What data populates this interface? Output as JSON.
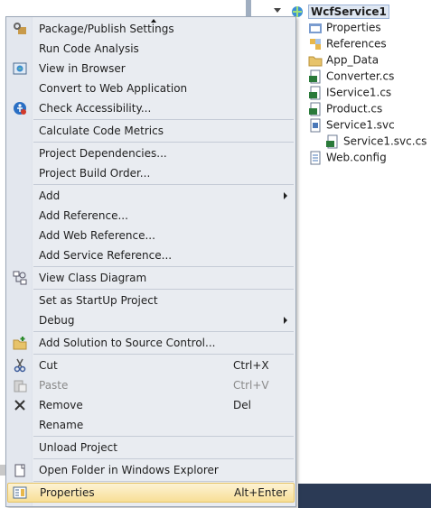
{
  "solution_explorer": {
    "root": "WcfService1",
    "items": [
      {
        "label": "Properties",
        "icon": "properties-folder-icon"
      },
      {
        "label": "References",
        "icon": "references-icon"
      },
      {
        "label": "App_Data",
        "icon": "folder-icon"
      },
      {
        "label": "Converter.cs",
        "icon": "csharp-file-icon"
      },
      {
        "label": "IService1.cs",
        "icon": "csharp-file-icon"
      },
      {
        "label": "Product.cs",
        "icon": "csharp-file-icon"
      },
      {
        "label": "Service1.svc",
        "icon": "svc-file-icon"
      },
      {
        "label": "Service1.svc.cs",
        "icon": "csharp-file-icon"
      },
      {
        "label": "Web.config",
        "icon": "config-file-icon"
      }
    ]
  },
  "context_menu": {
    "items": [
      {
        "label": "Package/Publish Settings",
        "icon": "package-settings-icon"
      },
      {
        "label": "Run Code Analysis"
      },
      {
        "label": "View in Browser",
        "icon": "view-in-browser-icon"
      },
      {
        "label": "Convert to Web Application"
      },
      {
        "label": "Check Accessibility...",
        "icon": "accessibility-icon"
      },
      {
        "label": "Calculate Code Metrics"
      },
      {
        "label": "Project Dependencies..."
      },
      {
        "label": "Project Build Order..."
      },
      {
        "label": "Add",
        "submenu": true
      },
      {
        "label": "Add Reference..."
      },
      {
        "label": "Add Web Reference..."
      },
      {
        "label": "Add Service Reference..."
      },
      {
        "label": "View Class Diagram",
        "icon": "class-diagram-icon"
      },
      {
        "label": "Set as StartUp Project"
      },
      {
        "label": "Debug",
        "submenu": true
      },
      {
        "label": "Add Solution to Source Control...",
        "icon": "source-control-icon"
      },
      {
        "label": "Cut",
        "shortcut": "Ctrl+X",
        "icon": "cut-icon"
      },
      {
        "label": "Paste",
        "shortcut": "Ctrl+V",
        "icon": "paste-icon",
        "disabled": true
      },
      {
        "label": "Remove",
        "shortcut": "Del",
        "icon": "remove-icon"
      },
      {
        "label": "Rename"
      },
      {
        "label": "Unload Project"
      },
      {
        "label": "Open Folder in Windows Explorer",
        "icon": "open-folder-icon"
      },
      {
        "label": "Properties",
        "shortcut": "Alt+Enter",
        "icon": "properties-icon",
        "highlighted": true
      }
    ]
  },
  "colors": {
    "menu_bg": "#e9ecf1",
    "highlight_bg": "#f8df96",
    "status_bar": "#2b3a55"
  }
}
